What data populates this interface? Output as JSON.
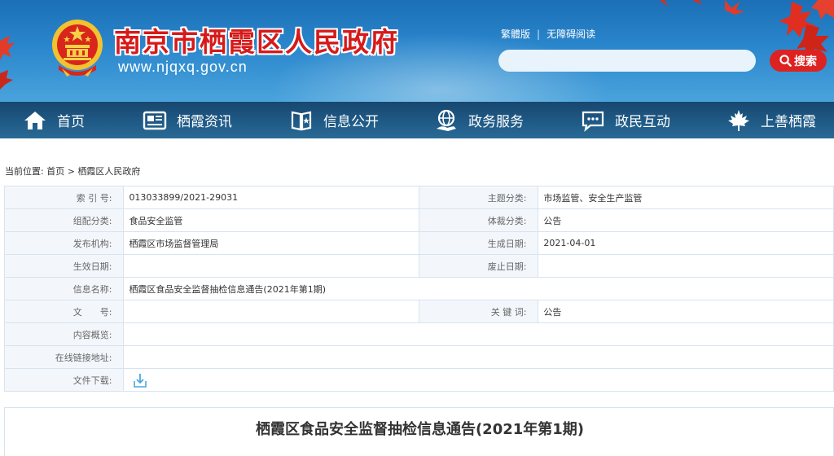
{
  "header": {
    "site_title": "南京市栖霞区人民政府",
    "site_url": "www.njqxq.gov.cn",
    "links": [
      "繁體版",
      "无障碍阅读"
    ],
    "search_placeholder": "",
    "search_button": "搜索"
  },
  "nav": {
    "items": [
      {
        "label": "首页",
        "icon": "home-icon"
      },
      {
        "label": "栖霞资讯",
        "icon": "news-icon"
      },
      {
        "label": "信息公开",
        "icon": "book-icon"
      },
      {
        "label": "政务服务",
        "icon": "globe-hand-icon"
      },
      {
        "label": "政民互动",
        "icon": "chat-icon"
      },
      {
        "label": "上善栖霞",
        "icon": "maple-leaf-icon"
      }
    ]
  },
  "breadcrumb": {
    "prefix": "当前位置:",
    "home": "首页",
    "separator": ">",
    "current": "栖霞区人民政府"
  },
  "meta": {
    "index_no_label": "索 引 号:",
    "index_no": "013033899/2021-29031",
    "topic_label": "主题分类:",
    "topic": "市场监管、安全生产监管",
    "org_cat_label": "组配分类:",
    "org_cat": "食品安全监管",
    "genre_label": "体裁分类:",
    "genre": "公告",
    "publisher_label": "发布机构:",
    "publisher": "栖霞区市场监督管理局",
    "created_label": "生成日期:",
    "created": "2021-04-01",
    "effective_label": "生效日期:",
    "effective": "",
    "expired_label": "废止日期:",
    "expired": "",
    "name_label": "信息名称:",
    "name": "栖霞区食品安全监督抽检信息通告(2021年第1期)",
    "doc_no_label": "文　　号:",
    "doc_no": "",
    "keywords_label": "关 键 词:",
    "keywords": "公告",
    "summary_label": "内容概览:",
    "summary": "",
    "online_link_label": "在线链接地址:",
    "online_link": "",
    "download_label": "文件下载:"
  },
  "article": {
    "title": "栖霞区食品安全监督抽检信息通告(2021年第1期)"
  },
  "colors": {
    "title_red": "#d61a1a",
    "nav_bg": "#1f5a86",
    "search_btn": "#dd2222",
    "label_bg": "#f3f7fb",
    "border": "#d7e3ee"
  }
}
